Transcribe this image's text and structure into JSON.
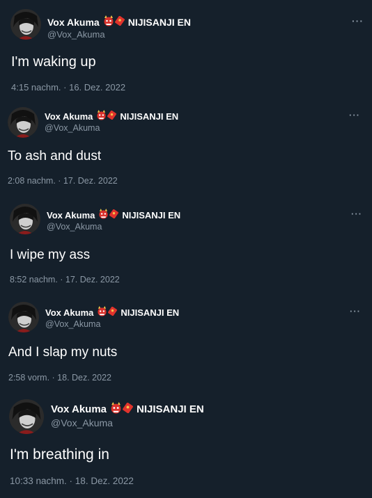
{
  "tweets": [
    {
      "display_name": "Vox Akuma",
      "affiliation": "NIJISANJI EN",
      "handle": "@Vox_Akuma",
      "text": "I'm waking up",
      "meta": "4:15 nachm. · 16. Dez. 2022",
      "more_glyph": "···",
      "icons": [
        "avatar-image",
        "oni-emoji-icon",
        "red-envelope-icon",
        "more-options-icon"
      ]
    },
    {
      "display_name": "Vox Akuma",
      "affiliation": "NIJISANJI EN",
      "handle": "@Vox_Akuma",
      "text": "To ash and dust",
      "meta": "2:08 nachm. · 17. Dez. 2022",
      "more_glyph": "···",
      "icons": [
        "avatar-image",
        "oni-emoji-icon",
        "red-envelope-icon",
        "more-options-icon"
      ]
    },
    {
      "display_name": "Vox Akuma",
      "affiliation": "NIJISANJI EN",
      "handle": "@Vox_Akuma",
      "text": "I wipe my ass",
      "meta": "8:52 nachm. · 17. Dez. 2022",
      "more_glyph": "···",
      "icons": [
        "avatar-image",
        "oni-emoji-icon",
        "red-envelope-icon",
        "more-options-icon"
      ]
    },
    {
      "display_name": "Vox Akuma",
      "affiliation": "NIJISANJI EN",
      "handle": "@Vox_Akuma",
      "text": "And I slap my nuts",
      "meta": "2:58 vorm. · 18. Dez. 2022",
      "more_glyph": "···",
      "icons": [
        "avatar-image",
        "oni-emoji-icon",
        "red-envelope-icon",
        "more-options-icon"
      ]
    },
    {
      "display_name": "Vox Akuma",
      "affiliation": "NIJISANJI EN",
      "handle": "@Vox_Akuma",
      "text": "I'm breathing in",
      "meta": "10:33 nachm. · 18. Dez. 2022",
      "more_glyph": "···",
      "icons": [
        "avatar-image",
        "oni-emoji-icon",
        "red-envelope-icon",
        "more-options-icon"
      ]
    }
  ],
  "colors": {
    "background": "#15202b",
    "primary_text": "#ffffff",
    "secondary_text": "#8b98a5",
    "oni_red": "#d9312b",
    "envelope_red": "#e0332c",
    "envelope_gold": "#f5c24c"
  }
}
